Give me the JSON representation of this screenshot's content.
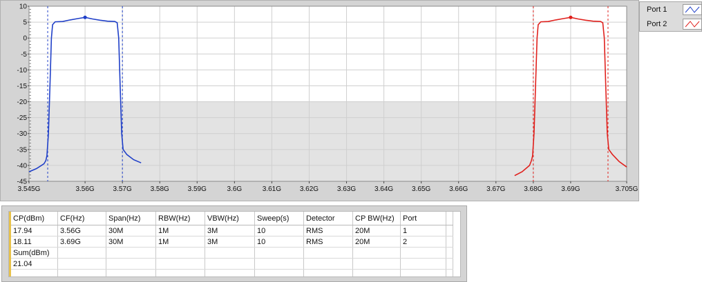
{
  "chart_data": {
    "type": "line",
    "xlim": [
      3.545,
      3.705
    ],
    "ylim": [
      -45,
      10
    ],
    "x_ticks": [
      3.545,
      3.56,
      3.57,
      3.58,
      3.59,
      3.6,
      3.61,
      3.62,
      3.63,
      3.64,
      3.65,
      3.66,
      3.67,
      3.68,
      3.69,
      3.705
    ],
    "x_tick_labels": [
      "3.545G",
      "3.56G",
      "3.57G",
      "3.58G",
      "3.59G",
      "3.6G",
      "3.61G",
      "3.62G",
      "3.63G",
      "3.64G",
      "3.65G",
      "3.66G",
      "3.67G",
      "3.68G",
      "3.69G",
      "3.705G"
    ],
    "y_ticks": [
      10,
      5,
      0,
      -5,
      -10,
      -15,
      -20,
      -25,
      -30,
      -35,
      -40,
      -45
    ],
    "y_tick_labels": [
      "10",
      "5",
      "0",
      "-5",
      "-10",
      "-15",
      "-20",
      "-25",
      "-30",
      "-35",
      "-40",
      "-45"
    ],
    "grid": true,
    "series": [
      {
        "name": "Port 1",
        "color": "#1f3fc8",
        "points": [
          [
            3.545,
            -42
          ],
          [
            3.547,
            -41
          ],
          [
            3.549,
            -39.5
          ],
          [
            3.5495,
            -38.5
          ],
          [
            3.5498,
            -37
          ],
          [
            3.5502,
            -30
          ],
          [
            3.5506,
            -15
          ],
          [
            3.551,
            0
          ],
          [
            3.5513,
            4.2
          ],
          [
            3.552,
            5.1
          ],
          [
            3.554,
            5.2
          ],
          [
            3.556,
            5.7
          ],
          [
            3.558,
            6.1
          ],
          [
            3.56,
            6.5
          ],
          [
            3.562,
            6.0
          ],
          [
            3.564,
            5.6
          ],
          [
            3.566,
            5.3
          ],
          [
            3.568,
            5.2
          ],
          [
            3.5686,
            4.8
          ],
          [
            3.569,
            0
          ],
          [
            3.5694,
            -15
          ],
          [
            3.5698,
            -30
          ],
          [
            3.5702,
            -35
          ],
          [
            3.5712,
            -36.6
          ],
          [
            3.573,
            -38.2
          ],
          [
            3.575,
            -39.2
          ]
        ],
        "marker": [
          3.56,
          6.5
        ],
        "cp_lines": [
          3.55,
          3.57
        ]
      },
      {
        "name": "Port 2",
        "color": "#e0201c",
        "points": [
          [
            3.675,
            -43.2
          ],
          [
            3.677,
            -42
          ],
          [
            3.679,
            -40
          ],
          [
            3.6795,
            -38.5
          ],
          [
            3.6798,
            -37
          ],
          [
            3.6802,
            -30
          ],
          [
            3.6806,
            -15
          ],
          [
            3.681,
            0
          ],
          [
            3.6813,
            4.2
          ],
          [
            3.682,
            5.1
          ],
          [
            3.684,
            5.2
          ],
          [
            3.686,
            5.7
          ],
          [
            3.688,
            6.1
          ],
          [
            3.69,
            6.5
          ],
          [
            3.692,
            6.0
          ],
          [
            3.694,
            5.6
          ],
          [
            3.696,
            5.3
          ],
          [
            3.698,
            5.2
          ],
          [
            3.6986,
            4.8
          ],
          [
            3.699,
            0
          ],
          [
            3.6994,
            -15
          ],
          [
            3.6998,
            -30
          ],
          [
            3.7002,
            -35
          ],
          [
            3.7012,
            -36.6
          ],
          [
            3.703,
            -38.8
          ],
          [
            3.705,
            -40.5
          ]
        ],
        "marker": [
          3.69,
          6.5
        ],
        "cp_lines": [
          3.68,
          3.7
        ]
      }
    ]
  },
  "legend": {
    "items": [
      {
        "label": "Port 1",
        "color": "#1f3fc8"
      },
      {
        "label": "Port 2",
        "color": "#e0201c"
      }
    ]
  },
  "table": {
    "headers": [
      "CP(dBm)",
      "CF(Hz)",
      "Span(Hz)",
      "RBW(Hz)",
      "VBW(Hz)",
      "Sweep(s)",
      "Detector",
      "CP BW(Hz)",
      "Port",
      ""
    ],
    "rows": [
      [
        "17.94",
        "3.56G",
        "30M",
        "1M",
        "3M",
        "10",
        "RMS",
        "20M",
        "1",
        ""
      ],
      [
        "18.11",
        "3.69G",
        "30M",
        "1M",
        "3M",
        "10",
        "RMS",
        "20M",
        "2",
        ""
      ],
      [
        "Sum(dBm)",
        "",
        "",
        "",
        "",
        "",
        "",
        "",
        "",
        ""
      ],
      [
        "21.04",
        "",
        "",
        "",
        "",
        "",
        "",
        "",
        "",
        ""
      ],
      [
        "",
        "",
        "",
        "",
        "",
        "",
        "",
        "",
        "",
        ""
      ]
    ]
  }
}
